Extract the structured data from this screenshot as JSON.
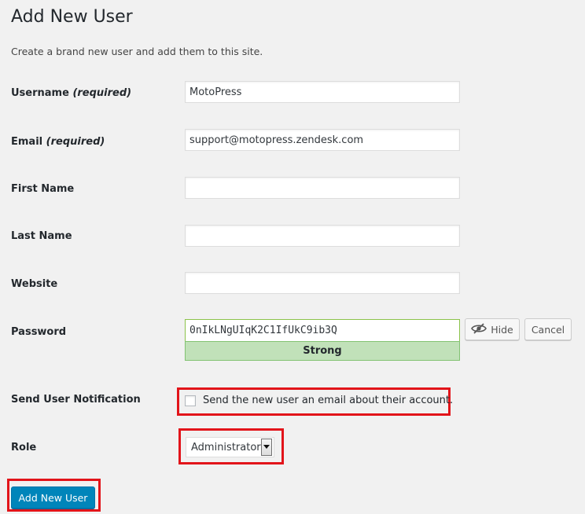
{
  "header": {
    "title": "Add New User",
    "description": "Create a brand new user and add them to this site."
  },
  "form": {
    "username": {
      "label": "Username",
      "required": "(required)",
      "value": "MotoPress"
    },
    "email": {
      "label": "Email",
      "required": "(required)",
      "value": "support@motopress.zendesk.com"
    },
    "first_name": {
      "label": "First Name",
      "value": ""
    },
    "last_name": {
      "label": "Last Name",
      "value": ""
    },
    "website": {
      "label": "Website",
      "value": ""
    },
    "password": {
      "label": "Password",
      "value": "0nIkLNgUIqK2C1IfUkC9ib3Q",
      "strength": "Strong",
      "hide_label": "Hide",
      "cancel_label": "Cancel"
    },
    "notification": {
      "label": "Send User Notification",
      "checkbox_text": "Send the new user an email about their account.",
      "checked": false
    },
    "role": {
      "label": "Role",
      "selected": "Administrator"
    },
    "submit_label": "Add New User"
  },
  "colors": {
    "primary_button": "#0085ba",
    "strength_bg": "#c1e1b9",
    "highlight": "#e2141a"
  },
  "icons": {
    "hide": "eye-slash-icon",
    "select": "dropdown-arrow-icon"
  }
}
